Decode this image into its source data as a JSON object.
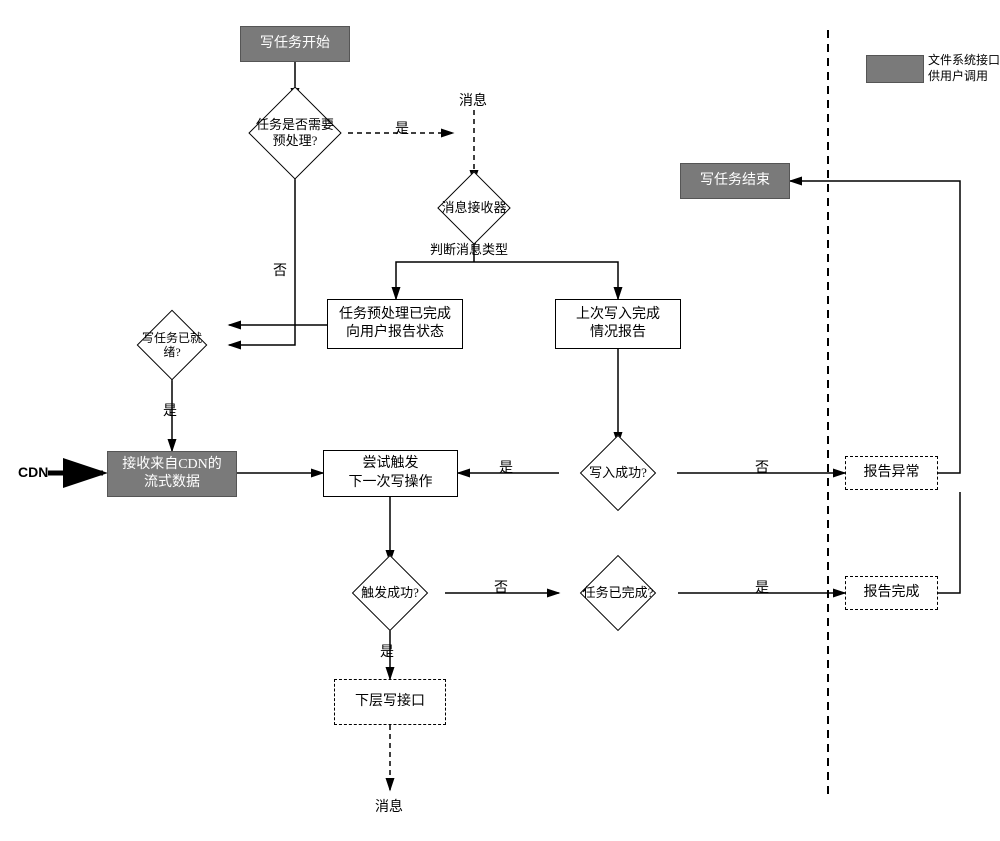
{
  "nodes": {
    "start": "写任务开始",
    "needpre": "任务是否需要\n预处理?",
    "msg_top": "消息",
    "receiver": "消息接收器",
    "judge_type": "判断消息类型",
    "ready": "写任务已就绪?",
    "pre_done": "任务预处理已完成\n向用户报告状态",
    "last_report": "上次写入完成\n情况报告",
    "recv_cdn": "接收来自CDN的\n流式数据",
    "cdn_label": "CDN",
    "try_trigger": "尝试触发\n下一次写操作",
    "write_ok": "写入成功?",
    "report_err": "报告异常",
    "trigger_ok": "触发成功?",
    "task_done": "任务已完成?",
    "report_done": "报告完成",
    "lower_write": "下层写接口",
    "msg_bottom": "消息",
    "end": "写任务结束",
    "legend_box": "",
    "legend_txt": "文件系统接口\n供用户调用"
  },
  "edges": {
    "yes": "是",
    "no": "否"
  }
}
